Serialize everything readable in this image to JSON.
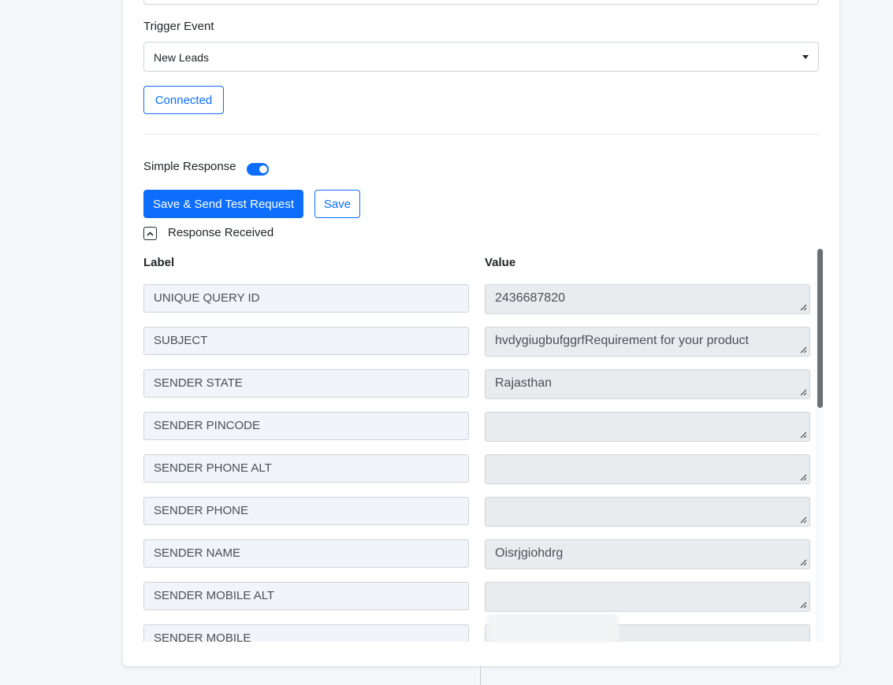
{
  "form": {
    "trigger_event_label": "Trigger Event",
    "trigger_event_value": "New Leads",
    "connected_label": "Connected",
    "simple_response_label": "Simple Response",
    "simple_response_on": true,
    "save_send_label": "Save & Send Test Request",
    "save_label": "Save",
    "response_received_label": "Response Received"
  },
  "table": {
    "label_header": "Label",
    "value_header": "Value",
    "rows": [
      {
        "label": "UNIQUE QUERY ID",
        "value": "2436687820"
      },
      {
        "label": "SUBJECT",
        "value": "hvdygiugbufggrfRequirement for your product"
      },
      {
        "label": "SENDER STATE",
        "value": "Rajasthan"
      },
      {
        "label": "SENDER PINCODE",
        "value": ""
      },
      {
        "label": "SENDER PHONE ALT",
        "value": ""
      },
      {
        "label": "SENDER PHONE",
        "value": ""
      },
      {
        "label": "SENDER NAME",
        "value": "Oisrjgiohdrg"
      },
      {
        "label": "SENDER MOBILE ALT",
        "value": ""
      },
      {
        "label": "SENDER MOBILE",
        "value": ""
      }
    ]
  }
}
